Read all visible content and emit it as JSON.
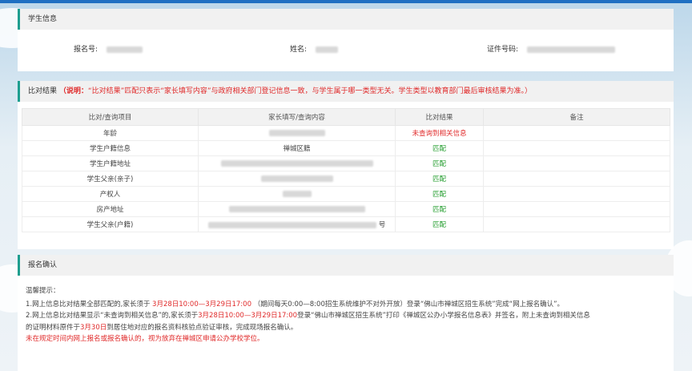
{
  "student_info": {
    "title": "学生信息",
    "reg_no_label": "报名号:",
    "name_label": "姓名:",
    "id_label": "证件号码:"
  },
  "compare": {
    "title": "比对结果",
    "note_bold": "（说明：",
    "note_text": "“比对结果”匹配只表示“家长填写内容”与政府相关部门登记信息一致，与学生属于哪一类型无关。学生类型以教育部门最后审核结果为准。）",
    "columns": [
      "比对/查询项目",
      "家长填写/查询内容",
      "比对结果",
      "备注"
    ],
    "rows": [
      {
        "item": "年龄",
        "content": "",
        "result": "未查询到相关信息",
        "status": "nomatch",
        "note": ""
      },
      {
        "item": "学生户籍信息",
        "content": "禅城区籍",
        "result": "匹配",
        "status": "match",
        "note": ""
      },
      {
        "item": "学生户籍地址",
        "content": "",
        "result": "匹配",
        "status": "match",
        "note": ""
      },
      {
        "item": "学生父亲(亲子)",
        "content": "",
        "result": "匹配",
        "status": "match",
        "note": ""
      },
      {
        "item": "产权人",
        "content": "",
        "result": "匹配",
        "status": "match",
        "note": ""
      },
      {
        "item": "房产地址",
        "content": "",
        "result": "匹配",
        "status": "match",
        "note": ""
      },
      {
        "item": "学生父亲(户籍)",
        "content": "号",
        "result": "匹配",
        "status": "match",
        "note": ""
      }
    ]
  },
  "confirm": {
    "title": "报名确认",
    "tips_title": "温馨提示：",
    "tip1_a": "1.网上信息比对结果全部匹配的,家长须于",
    "tip1_date": "3月28日10:00—3月29日17:00",
    "tip1_b": "（期间每天0:00—8:00招生系统维护不对外开放）登录“佛山市禅城区招生系统”完成“网上报名确认”。",
    "tip2_a": "2.网上信息比对结果显示“未查询到相关信息”的,家长须于",
    "tip2_date": "3月28日10:00—3月29日17:00",
    "tip2_b": "登录“佛山市禅城区招生系统”打印《禅城区公办小学报名信息表》并签名，附上未查询到相关信息",
    "tip2_c": "的证明材料原件于",
    "tip2_date2": "3月30日",
    "tip2_d": "到居住地对应的报名资料核验点验证审核，完成现场报名确认。",
    "warning": "未在规定时间内网上报名或报名确认的，视为放弃在禅城区申请公办学校学位。"
  }
}
